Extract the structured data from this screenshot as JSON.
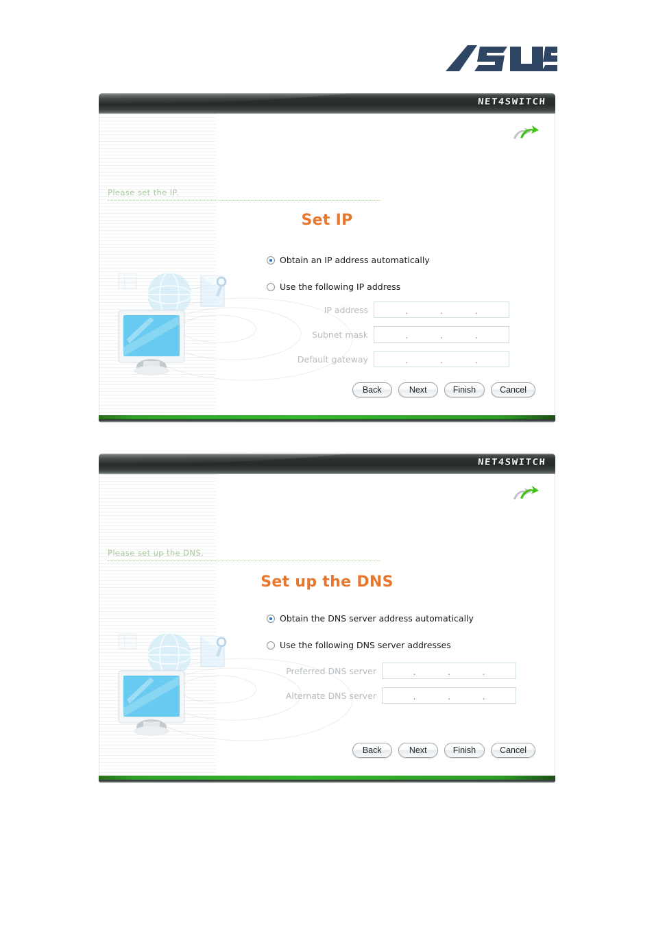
{
  "brand": {
    "logo_text": "ASUS",
    "registered_mark": "®",
    "logo_color": "#2e4663"
  },
  "dialogs": [
    {
      "id": "set-ip",
      "titlebar_brand": "NET4SWITCH",
      "arrow_icon": "refresh-arrow-icon",
      "instruction": "Please set the IP.",
      "heading": "Set IP",
      "heading_color": "#e8762c",
      "radios": [
        {
          "label": "Obtain an IP address automatically",
          "selected": true
        },
        {
          "label": "Use the following IP address",
          "selected": false
        }
      ],
      "fields": [
        {
          "label": "IP address",
          "value": "",
          "separator": ".",
          "disabled": true
        },
        {
          "label": "Subnet mask",
          "value": "",
          "separator": ".",
          "disabled": true
        },
        {
          "label": "Default gateway",
          "value": "",
          "separator": ".",
          "disabled": true
        }
      ],
      "buttons": [
        "Back",
        "Next",
        "Finish",
        "Cancel"
      ]
    },
    {
      "id": "set-up-dns",
      "titlebar_brand": "NET4SWITCH",
      "arrow_icon": "refresh-arrow-icon",
      "instruction": "Please set up the DNS.",
      "heading": "Set up the DNS",
      "heading_color": "#e8762c",
      "radios": [
        {
          "label": "Obtain the DNS server address automatically",
          "selected": true
        },
        {
          "label": "Use the following DNS server addresses",
          "selected": false
        }
      ],
      "fields": [
        {
          "label": "Preferred DNS server",
          "value": "",
          "separator": ".",
          "disabled": true
        },
        {
          "label": "Alternate DNS server",
          "value": "",
          "separator": ".",
          "disabled": true
        }
      ],
      "buttons": [
        "Back",
        "Next",
        "Finish",
        "Cancel"
      ]
    }
  ],
  "artwork": {
    "name": "network-monitor-globe-illustration",
    "elements": [
      "monitor-icon",
      "globe-icon",
      "document-key-icon",
      "orbit-ellipses"
    ]
  },
  "theme": {
    "accent_green": "#35b52e",
    "instruction_green": "#a5c79a",
    "heading_orange": "#e8762c",
    "titlebar_dark": "#262b29",
    "field_border": "#cfdde4",
    "disabled_label": "#b6bcc0",
    "radio_dot": "#1c6fce"
  }
}
